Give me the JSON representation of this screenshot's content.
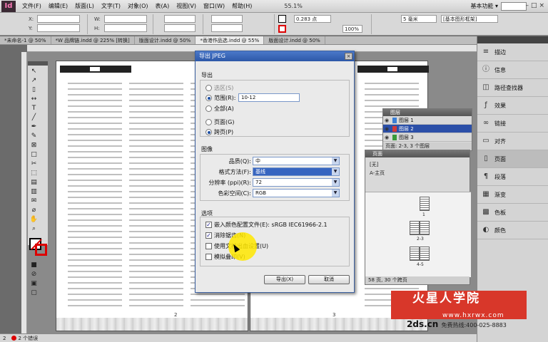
{
  "app": {
    "logo": "Id"
  },
  "menu": {
    "items": [
      "文件(F)",
      "编辑(E)",
      "版面(L)",
      "文字(T)",
      "对象(O)",
      "表(A)",
      "视图(V)",
      "窗口(W)",
      "帮助(H)"
    ],
    "zoom": "55.1%",
    "workspace": "基本功能 ▾"
  },
  "control": {
    "x_label": "X:",
    "y_label": "Y:",
    "w_label": "W:",
    "h_label": "H:",
    "stroke_weight": "0.283 点",
    "percent": "100%",
    "mm": "5 毫米",
    "frame_style": "[基本图形框架]"
  },
  "tabs": [
    "*未命名-1 @ 50%",
    "*W 品牌链.indd @ 225% [转换]",
    "版面设计.indd @ 50%",
    "*香港作品选.indd @ 55%",
    "版面设计.indd @ 50%"
  ],
  "tabs_active": 3,
  "document": {
    "page_left": "2",
    "page_right": "3"
  },
  "status": {
    "page": "2",
    "errors": "2 个错误"
  },
  "right_panel": {
    "items": [
      "描边",
      "信息",
      "路径查找器",
      "效果",
      "链接",
      "对齐",
      "页面",
      "段落",
      "渐变",
      "色板",
      "颜色"
    ],
    "selected": 6
  },
  "layers_panel": {
    "title": "图层",
    "layers": [
      {
        "name": "图层 1",
        "color": "#3a7fd6"
      },
      {
        "name": "图层 2",
        "color": "#d23a3a"
      },
      {
        "name": "图层 3",
        "color": "#3a9a3a"
      }
    ],
    "selected": 1,
    "footer": "页面: 2-3, 3 个图层"
  },
  "pages_panel": {
    "title": "页面",
    "none": "[无]",
    "master": "A-主页",
    "thumbs": [
      "1",
      "2-3",
      "4-5"
    ],
    "footer": "58 页, 30 个跨页"
  },
  "dialog": {
    "title": "导出 JPEG",
    "close": "×",
    "export_label": "导出",
    "selection": "选区(S)",
    "range_label": "范围(R):",
    "range_value": "10-12",
    "all": "全部(A)",
    "pages": "页面(G)",
    "spreads": "跨页(P)",
    "image_label": "图像",
    "quality_label": "品质(Q):",
    "quality_value": "中",
    "format_label": "格式方法(F):",
    "format_value": "基线",
    "resolution_label": "分辨率 (ppi)(R):",
    "resolution_value": "72",
    "color_space_label": "色彩空间(C):",
    "color_space_value": "RGB",
    "options_label": "选项",
    "embed_profile": "嵌入颜色配置文件(E): sRGB IEC61966-2.1",
    "antialias": "消除锯齿(N)",
    "bleed": "使用文档出血设置(U)",
    "overprint": "模拟叠印(V)",
    "ok": "导出(X)",
    "cancel": "取消"
  },
  "watermark": {
    "brand": "火星人学院",
    "url": "www.hxrwx.com",
    "line2_site": "2ds.cn",
    "line2_text": "免费热线:400-025-8883"
  }
}
